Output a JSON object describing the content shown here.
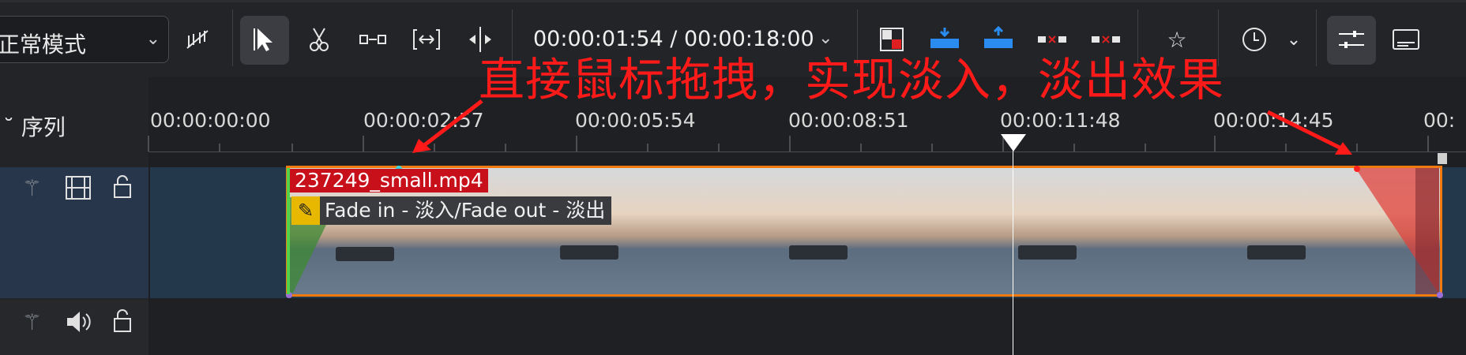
{
  "toolbar": {
    "mode_label": "正常模式",
    "timecode": "00:00:01:54 / 00:00:18:00"
  },
  "timeline": {
    "sequence_label": "序列",
    "ruler_ticks": [
      "00:00:00:00",
      "00:00:02:57",
      "00:00:05:54",
      "00:00:08:51",
      "00:00:11:48",
      "00:00:14:45",
      "00:"
    ]
  },
  "clip": {
    "title": "237249_small.mp4",
    "effect_label": "Fade in - 淡入/Fade out - 淡出"
  },
  "annotation": {
    "text": "直接鼠标拖拽，实现淡入，淡出效果",
    "color": "#ff1a1a"
  },
  "icons": {
    "mode_chevron": "chevron-down-icon",
    "spacer_tool": "spacer-icon",
    "select_tool": "cursor-arrow-icon",
    "razor_tool": "scissors-icon",
    "slip_tool": "slip-icon",
    "ripple_tool": "ripple-icon",
    "split_tool": "split-icon",
    "overwrite": "overwrite-icon",
    "insert": "insert-icon",
    "lift": "lift-icon",
    "extract": "extract-icon",
    "star": "star-icon",
    "marker": "marker-icon",
    "mixer": "mixer-icon",
    "subtitle": "subtitle-icon"
  },
  "colors": {
    "clip_border": "#f07a10",
    "clip_title_bg": "#c8101a",
    "fade_out": "#e0403a",
    "fade_in": "#3e8a33"
  }
}
